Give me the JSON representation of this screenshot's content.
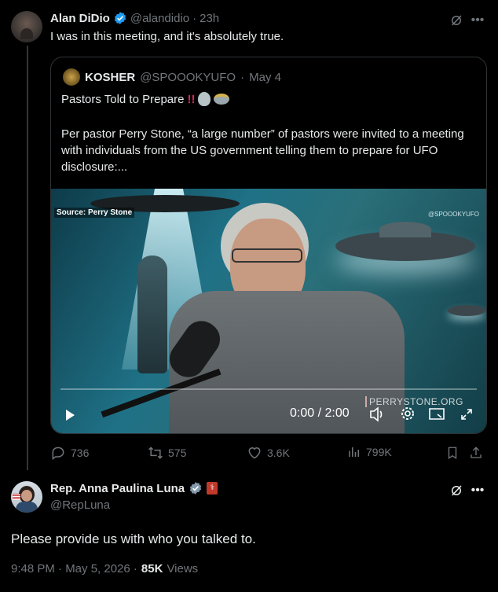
{
  "tweet": {
    "author_name": "Alan DiDio",
    "handle": "@alandidio",
    "time": "23h",
    "text": "I was in this meeting, and it's absolutely true.",
    "stats": {
      "replies": "736",
      "reposts": "575",
      "likes": "3.6K",
      "views": "799K"
    }
  },
  "quote": {
    "author_name": "KOSHER",
    "handle": "@SPOOOKYUFO",
    "date": "May 4",
    "title": "Pastors Told to Prepare",
    "body": "Per pastor Perry Stone, “a large number” of pastors were invited to a meeting with individuals from the US government telling them to prepare for UFO disclosure:...",
    "video": {
      "source_label": "Source: Perry Stone",
      "watermark": "@SPOOOKYUFO",
      "site": "PERRYSTONE.ORG",
      "time_display": "0:00 / 2:00"
    }
  },
  "reply": {
    "author_name": "Rep. Anna Paulina Luna",
    "handle": "@RepLuna",
    "text": "Please provide us with who you talked to.",
    "timestamp": "9:48 PM · May 5, 2026 ·",
    "views_count": "85K",
    "views_label": "Views"
  },
  "colors": {
    "background": "#000000",
    "text": "#e7e9ea",
    "muted": "#71767b",
    "verified": "#1d9bf0",
    "border": "#2f3336"
  },
  "icons": [
    "verified-badge-icon",
    "grok-icon",
    "more-icon",
    "reply-icon",
    "repost-icon",
    "like-icon",
    "views-icon",
    "bookmark-icon",
    "share-icon",
    "play-icon",
    "captions-icon",
    "settings-icon",
    "pip-icon",
    "fullscreen-icon"
  ]
}
